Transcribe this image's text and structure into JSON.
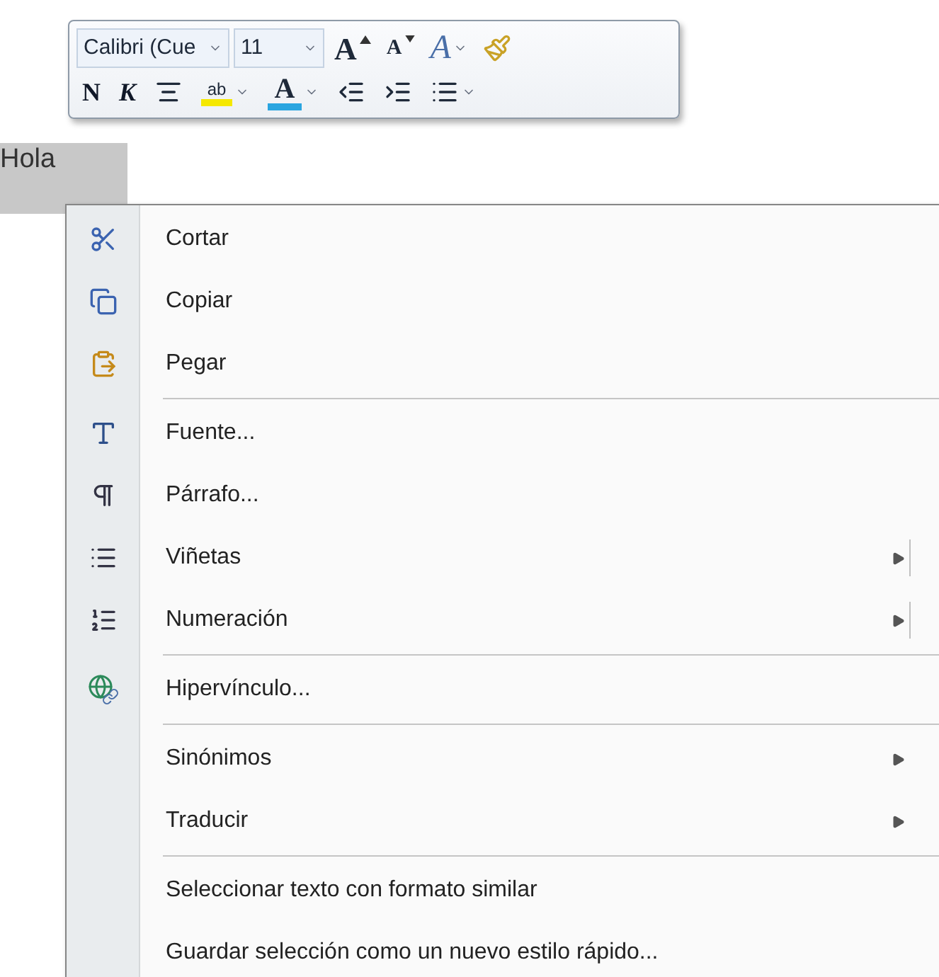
{
  "toolbar": {
    "font_name": {
      "value": "Calibri (Cue"
    },
    "font_size": {
      "value": "11"
    },
    "row1": [
      {
        "kind": "grow",
        "glyph": "A"
      },
      {
        "kind": "shrink",
        "glyph": "A"
      },
      {
        "kind": "styles",
        "glyph": "A"
      },
      {
        "kind": "painter"
      }
    ],
    "row2": [
      {
        "kind": "bold",
        "glyph": "N"
      },
      {
        "kind": "italic",
        "glyph": "K"
      },
      {
        "kind": "center"
      },
      {
        "kind": "highlight",
        "glyph": "ab"
      },
      {
        "kind": "color",
        "glyph": "A"
      },
      {
        "kind": "outdent"
      },
      {
        "kind": "indent"
      },
      {
        "kind": "bullets"
      }
    ]
  },
  "document": {
    "text": "Hola"
  },
  "context_menu": [
    {
      "kind": "item",
      "label": "Cortar",
      "submenu": false,
      "split": false
    },
    {
      "kind": "item",
      "label": "Copiar",
      "submenu": false,
      "split": false
    },
    {
      "kind": "item",
      "label": "Pegar",
      "submenu": false,
      "split": false
    },
    {
      "kind": "separator"
    },
    {
      "kind": "item",
      "label": "Fuente...",
      "submenu": false,
      "split": false
    },
    {
      "kind": "item",
      "label": "Párrafo...",
      "submenu": false,
      "split": false
    },
    {
      "kind": "item",
      "label": "Viñetas",
      "submenu": true,
      "split": true
    },
    {
      "kind": "item",
      "label": "Numeración",
      "submenu": true,
      "split": true
    },
    {
      "kind": "separator"
    },
    {
      "kind": "item",
      "label": "Hipervínculo...",
      "submenu": false,
      "split": false
    },
    {
      "kind": "separator"
    },
    {
      "kind": "item",
      "label": "Sinónimos",
      "submenu": true,
      "split": false
    },
    {
      "kind": "item",
      "label": "Traducir",
      "submenu": true,
      "split": false
    },
    {
      "kind": "separator"
    },
    {
      "kind": "item",
      "label": "Seleccionar texto con formato similar",
      "submenu": false,
      "split": false
    },
    {
      "kind": "item",
      "label": "Guardar selección como un nuevo estilo rápido...",
      "submenu": false,
      "split": false
    }
  ]
}
